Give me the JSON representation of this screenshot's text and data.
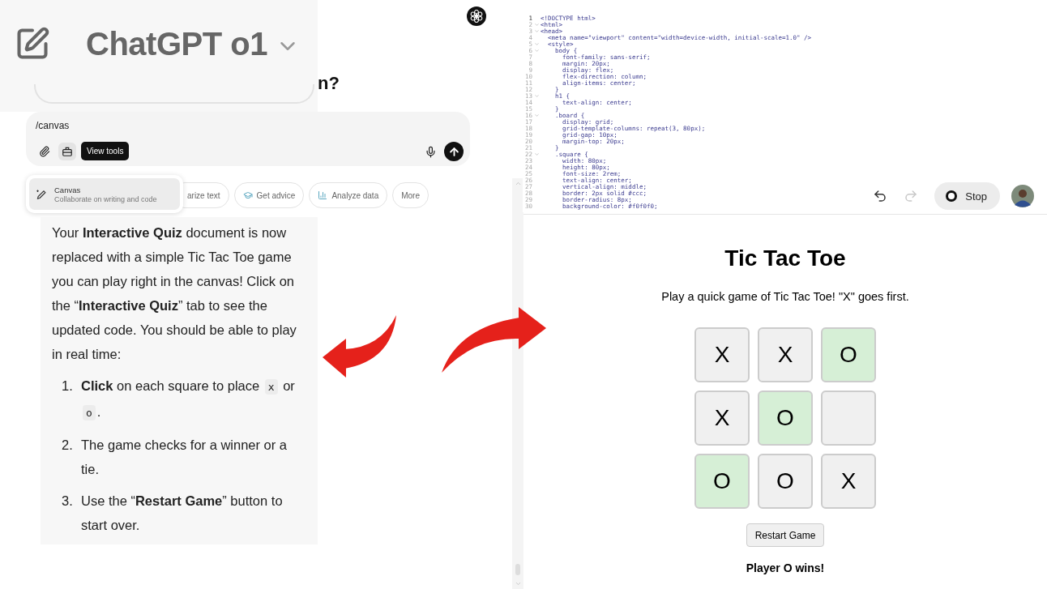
{
  "header": {
    "title": "ChatGPT o1"
  },
  "heading_fragment": "n?",
  "composer": {
    "value": "/canvas",
    "tooltip": "View tools"
  },
  "tools_menu": {
    "items": [
      {
        "title": "Canvas",
        "subtitle": "Collaborate on writing and code",
        "selected": true
      }
    ]
  },
  "suggestions": [
    {
      "label": "arize text",
      "kind": "plain"
    },
    {
      "label": "Get advice",
      "kind": "advice"
    },
    {
      "label": "Analyze data",
      "kind": "analysis"
    },
    {
      "label": "More",
      "kind": "plain"
    }
  ],
  "message": {
    "paragraph": "Your **Interactive Quiz** document is now replaced with a simple Tic Tac Toe game you can play right in the canvas! Click on the “**Interactive Quiz**” tab to see the updated code. You should be able to play in real time:",
    "steps": [
      {
        "number": "1.",
        "parts": [
          {
            "kind": "text",
            "text": "**Click** on each square to place"
          },
          {
            "kind": "code",
            "text": "x"
          },
          {
            "kind": "text",
            "text": "or"
          },
          {
            "kind": "code",
            "text": "o"
          },
          {
            "kind": "tail",
            "text": "."
          }
        ]
      },
      {
        "number": "2.",
        "parts": [
          {
            "kind": "text",
            "text": "The game checks for a winner or a tie."
          }
        ]
      },
      {
        "number": "3.",
        "parts": [
          {
            "kind": "text",
            "text": "Use the “**Restart Game**” button to start over."
          }
        ]
      }
    ]
  },
  "code_editor": {
    "lines": [
      {
        "number": "1",
        "text": "<!DOCTYPE html>",
        "foldable": false
      },
      {
        "number": "2",
        "text": "<html>",
        "foldable": true
      },
      {
        "number": "3",
        "text": "<head>",
        "foldable": true
      },
      {
        "number": "4",
        "text": "  <meta name=\"viewport\" content=\"width=device-width, initial-scale=1.0\" />",
        "foldable": false
      },
      {
        "number": "5",
        "text": "  <style>",
        "foldable": true
      },
      {
        "number": "6",
        "text": "    body {",
        "foldable": true
      },
      {
        "number": "7",
        "text": "      font-family: sans-serif;",
        "foldable": false
      },
      {
        "number": "8",
        "text": "      margin: 20px;",
        "foldable": false
      },
      {
        "number": "9",
        "text": "      display: flex;",
        "foldable": false
      },
      {
        "number": "10",
        "text": "      flex-direction: column;",
        "foldable": false
      },
      {
        "number": "11",
        "text": "      align-items: center;",
        "foldable": false
      },
      {
        "number": "12",
        "text": "    }",
        "foldable": false
      },
      {
        "number": "13",
        "text": "    h1 {",
        "foldable": true
      },
      {
        "number": "14",
        "text": "      text-align: center;",
        "foldable": false
      },
      {
        "number": "15",
        "text": "    }",
        "foldable": false
      },
      {
        "number": "16",
        "text": "    .board {",
        "foldable": true
      },
      {
        "number": "17",
        "text": "      display: grid;",
        "foldable": false
      },
      {
        "number": "18",
        "text": "      grid-template-columns: repeat(3, 80px);",
        "foldable": false
      },
      {
        "number": "19",
        "text": "      grid-gap: 10px;",
        "foldable": false
      },
      {
        "number": "20",
        "text": "      margin-top: 20px;",
        "foldable": false
      },
      {
        "number": "21",
        "text": "    }",
        "foldable": false
      },
      {
        "number": "22",
        "text": "    .square {",
        "foldable": true
      },
      {
        "number": "23",
        "text": "      width: 80px;",
        "foldable": false
      },
      {
        "number": "24",
        "text": "      height: 80px;",
        "foldable": false
      },
      {
        "number": "25",
        "text": "      font-size: 2rem;",
        "foldable": false
      },
      {
        "number": "26",
        "text": "      text-align: center;",
        "foldable": false
      },
      {
        "number": "27",
        "text": "      vertical-align: middle;",
        "foldable": false
      },
      {
        "number": "28",
        "text": "      border: 2px solid #ccc;",
        "foldable": false
      },
      {
        "number": "29",
        "text": "      border-radius: 8px;",
        "foldable": false
      },
      {
        "number": "30",
        "text": "      background-color: #f0f0f0;",
        "foldable": false
      }
    ]
  },
  "toolbar": {
    "undo_disabled": false,
    "redo_disabled": true,
    "stop_label": "Stop"
  },
  "preview": {
    "title": "Tic Tac Toe",
    "subtitle": "Play a quick game of Tic Tac Toe! \"X\" goes first.",
    "cells": [
      {
        "mark": "X",
        "winning": false
      },
      {
        "mark": "X",
        "winning": false
      },
      {
        "mark": "O",
        "winning": true
      },
      {
        "mark": "X",
        "winning": false
      },
      {
        "mark": "O",
        "winning": true
      },
      {
        "winning": false
      },
      {
        "mark": "O",
        "winning": true
      },
      {
        "mark": "O",
        "winning": false
      },
      {
        "mark": "X",
        "winning": false
      }
    ],
    "restart_label": "Restart Game",
    "status": "Player O wins!"
  }
}
